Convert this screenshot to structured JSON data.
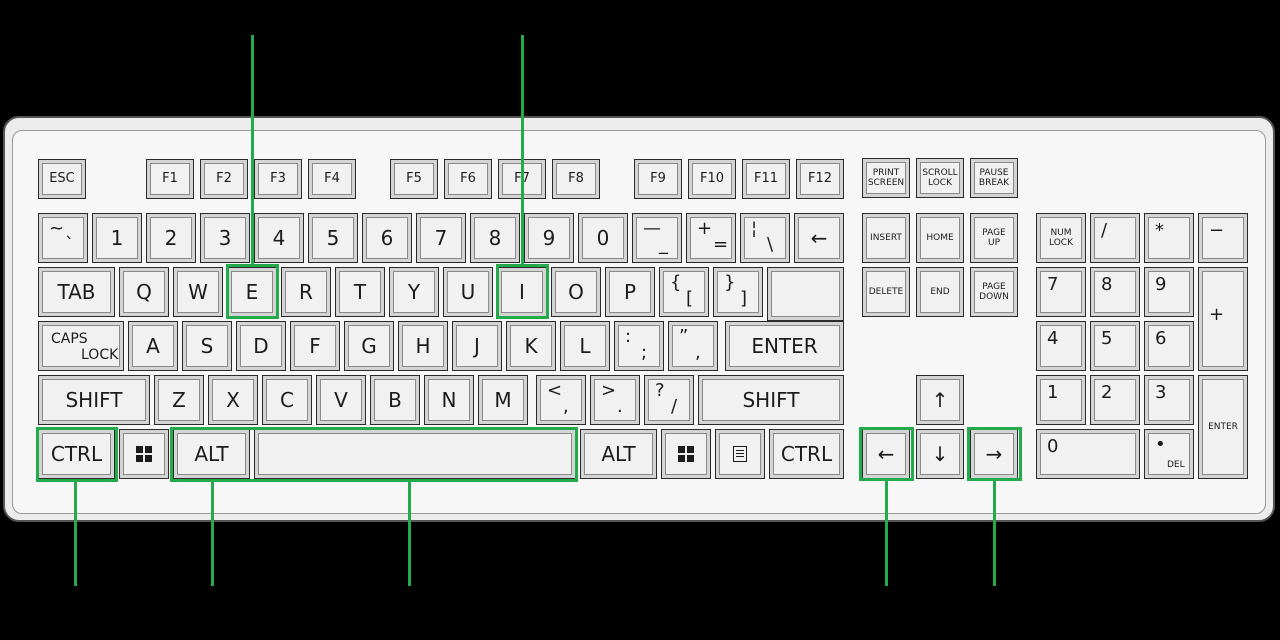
{
  "colors": {
    "highlight": "#22aa4d",
    "key_face": "#f1f1f1",
    "background": "#000000"
  },
  "keys": {
    "esc": "ESC",
    "f": [
      "F1",
      "F2",
      "F3",
      "F4",
      "F5",
      "F6",
      "F7",
      "F8",
      "F9",
      "F10",
      "F11",
      "F12"
    ],
    "print_screen": "PRINT\nSCREEN",
    "scroll_lock": "SCROLL\nLOCK",
    "pause_break": "PAUSE\nBREAK",
    "tilde_top": "~",
    "tilde_bottom": "`",
    "digits": [
      "1",
      "2",
      "3",
      "4",
      "5",
      "6",
      "7",
      "8",
      "9",
      "0"
    ],
    "minus_top": "—",
    "minus_bottom": "_",
    "plus_top": "+",
    "plus_bottom": "=",
    "pipe_top": "¦",
    "pipe_bottom": "\\",
    "backspace": "←",
    "insert": "INSERT",
    "home": "HOME",
    "page_up": "PAGE\nUP",
    "delete": "DELETE",
    "end": "END",
    "page_down": "PAGE\nDOWN",
    "tab": "TAB",
    "row_q": [
      "Q",
      "W",
      "E",
      "R",
      "T",
      "Y",
      "U",
      "I",
      "O",
      "P"
    ],
    "brace_open_top": "{",
    "brace_open_bottom": "[",
    "brace_close_top": "}",
    "brace_close_bottom": "]",
    "caps_top": "CAPS",
    "caps_bottom": "LOCK",
    "row_a": [
      "A",
      "S",
      "D",
      "F",
      "G",
      "H",
      "J",
      "K",
      "L"
    ],
    "colon_top": ":",
    "colon_bottom": ";",
    "quote_top": "”",
    "quote_bottom": ",",
    "enter": "ENTER",
    "shift": "SHIFT",
    "row_z": [
      "Z",
      "X",
      "C",
      "V",
      "B",
      "N",
      "M"
    ],
    "lt_top": "<",
    "lt_bottom": ",",
    "gt_top": ">",
    "gt_bottom": ".",
    "qm_top": "?",
    "qm_bottom": "/",
    "ctrl": "CTRL",
    "alt": "ALT",
    "arrow_up": "↑",
    "arrow_left": "←",
    "arrow_down": "↓",
    "arrow_right": "→",
    "num_lock": "NUM\nLOCK",
    "num_div": "/",
    "num_mul": "*",
    "num_minus": "−",
    "num_plus": "+",
    "num_enter": "ENTER",
    "num_0": "0",
    "num_del_top": "•",
    "num_del_bottom": "DEL",
    "num_row1": [
      "7",
      "8",
      "9"
    ],
    "num_row2": [
      "4",
      "5",
      "6"
    ],
    "num_row3": [
      "1",
      "2",
      "3"
    ]
  },
  "icons": {
    "windows": "windows-logo-icon",
    "menu": "context-menu-icon"
  }
}
